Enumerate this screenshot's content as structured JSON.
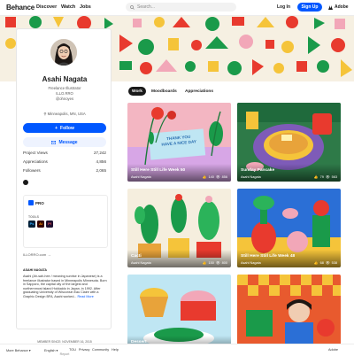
{
  "header": {
    "logo": "Behance",
    "nav": [
      "Discover",
      "Watch",
      "Jobs"
    ],
    "search_placeholder": "Search...",
    "login": "Log In",
    "signup": "Sign Up",
    "adobe": "Adobe"
  },
  "profile": {
    "name": "Asahi Nagata",
    "titles": [
      "Freelance Illustrator",
      "ILLO.RRO",
      "@ohnoyes"
    ],
    "location": "Minneapolis, MN, USA",
    "follow": "Follow",
    "message": "Message",
    "stats": [
      {
        "label": "Project Views",
        "value": "27,242"
      },
      {
        "label": "Appreciations",
        "value": "4,856"
      },
      {
        "label": "Followers",
        "value": "2,065"
      }
    ],
    "pro": "PRO",
    "tools_label": "TOOLS",
    "tools": [
      "Ps",
      "Ai",
      "Pf"
    ],
    "link": "ILLORRO.com →",
    "about_heading": "ASAHI NAGATA",
    "about": "Asahi (Ah-sah-hee / meaning sunrise in Japanese) is a freelance illustrator based in Minneapolis Minnesota. Born in Sapporo, the capital city of the largest and northernmost island Hokkaido in Japan, in 1992. After graduating University of Wisconsin Eau Claire with a Graphic Design BFA, Asahi worked...",
    "read_more": "Read More",
    "member_since": "MEMBER SINCE: NOVEMBER 16, 2015",
    "report": "Report"
  },
  "tabs": [
    "Work",
    "Moodboards",
    "Appreciations"
  ],
  "projects": [
    {
      "title": "Still Here Still Life Week 50",
      "owner": "Asahi Nagata",
      "likes": "140",
      "views": "856"
    },
    {
      "title": "Sunday Pancake",
      "owner": "Asahi Nagata",
      "likes": "79",
      "views": "563"
    },
    {
      "title": "Cacti",
      "owner": "Asahi Nagata",
      "likes": "150",
      "views": "800"
    },
    {
      "title": "Still Here Still Life Week 48",
      "owner": "Asahi Nagata",
      "likes": "68",
      "views": "538"
    },
    {
      "title": "Dessert",
      "owner": "",
      "likes": "",
      "views": ""
    },
    {
      "title": "",
      "owner": "",
      "likes": "",
      "views": ""
    }
  ],
  "tile_texts": {
    "thank_you": [
      "THANK YOU",
      "HAVE A NICE DAY"
    ]
  },
  "footer": {
    "lang": "More Behance ▾",
    "links": [
      "English ▾",
      "TOU",
      "Privacy",
      "Community",
      "Help"
    ],
    "adobe": "Adobe"
  },
  "colors": {
    "accent": "#0057ff",
    "banner_green": "#1a9a4a",
    "banner_red": "#e83a2e",
    "banner_yellow": "#f5c43a",
    "banner_pink": "#f2a7b8"
  }
}
